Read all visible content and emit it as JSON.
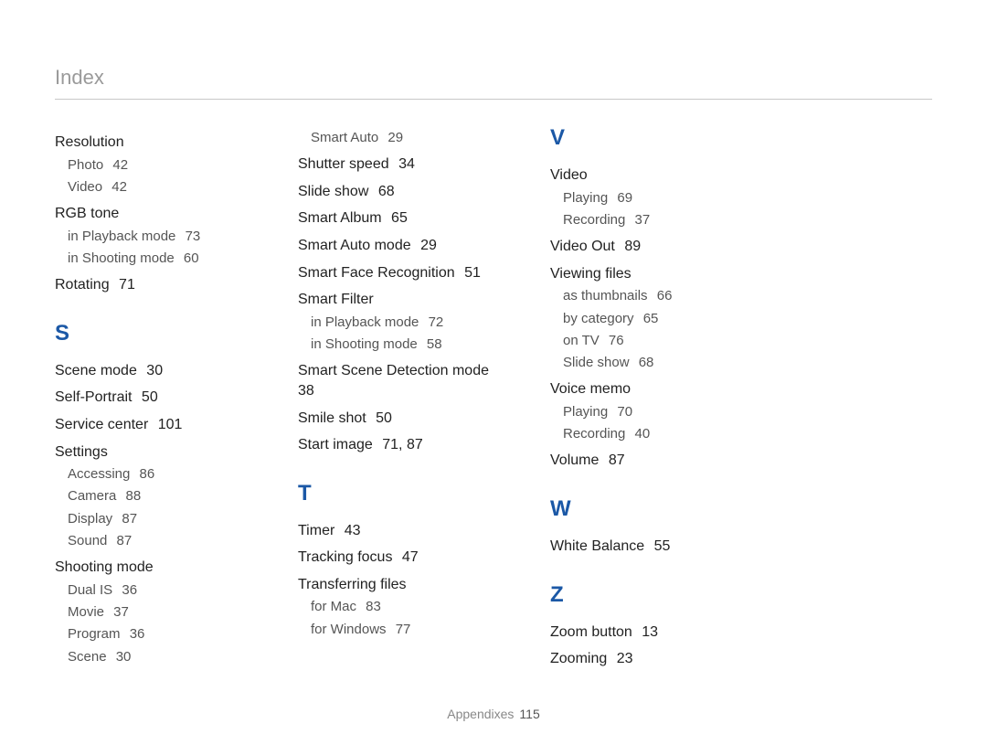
{
  "header": {
    "title": "Index"
  },
  "footer": {
    "label": "Appendixes",
    "page": "115"
  },
  "col1": [
    {
      "type": "entry",
      "label": "Resolution"
    },
    {
      "type": "sub",
      "label": "Photo",
      "page": "42"
    },
    {
      "type": "sub",
      "label": "Video",
      "page": "42"
    },
    {
      "type": "entry",
      "label": "RGB tone"
    },
    {
      "type": "sub",
      "label": "in Playback mode",
      "page": "73"
    },
    {
      "type": "sub",
      "label": "in Shooting mode",
      "page": "60"
    },
    {
      "type": "entry",
      "label": "Rotating",
      "page": "71"
    },
    {
      "type": "letter",
      "label": "S"
    },
    {
      "type": "entry",
      "label": "Scene mode",
      "page": "30"
    },
    {
      "type": "entry",
      "label": "Self-Portrait",
      "page": "50"
    },
    {
      "type": "entry",
      "label": "Service center",
      "page": "101"
    },
    {
      "type": "entry",
      "label": "Settings"
    },
    {
      "type": "sub",
      "label": "Accessing",
      "page": "86"
    },
    {
      "type": "sub",
      "label": "Camera",
      "page": "88"
    },
    {
      "type": "sub",
      "label": "Display",
      "page": "87"
    },
    {
      "type": "sub",
      "label": "Sound",
      "page": "87"
    },
    {
      "type": "entry",
      "label": "Shooting mode"
    },
    {
      "type": "sub",
      "label": "Dual IS",
      "page": "36"
    },
    {
      "type": "sub",
      "label": "Movie",
      "page": "37"
    },
    {
      "type": "sub",
      "label": "Program",
      "page": "36"
    },
    {
      "type": "sub",
      "label": "Scene",
      "page": "30"
    }
  ],
  "col2": [
    {
      "type": "sub",
      "label": "Smart Auto",
      "page": "29"
    },
    {
      "type": "entry",
      "label": "Shutter speed",
      "page": "34"
    },
    {
      "type": "entry",
      "label": "Slide show",
      "page": "68"
    },
    {
      "type": "entry",
      "label": "Smart Album",
      "page": "65"
    },
    {
      "type": "entry",
      "label": "Smart Auto mode",
      "page": "29"
    },
    {
      "type": "entry",
      "label": "Smart Face Recognition",
      "page": "51"
    },
    {
      "type": "entry",
      "label": "Smart Filter"
    },
    {
      "type": "sub",
      "label": "in Playback mode",
      "page": "72"
    },
    {
      "type": "sub",
      "label": "in Shooting mode",
      "page": "58"
    },
    {
      "type": "entry",
      "label": "Smart Scene Detection mode",
      "page": "38"
    },
    {
      "type": "entry",
      "label": "Smile shot",
      "page": "50"
    },
    {
      "type": "entry",
      "label": "Start image",
      "page": "71, 87"
    },
    {
      "type": "letter",
      "label": "T"
    },
    {
      "type": "entry",
      "label": "Timer",
      "page": "43"
    },
    {
      "type": "entry",
      "label": "Tracking focus",
      "page": "47"
    },
    {
      "type": "entry",
      "label": "Transferring files"
    },
    {
      "type": "sub",
      "label": "for Mac",
      "page": "83"
    },
    {
      "type": "sub",
      "label": "for Windows",
      "page": "77"
    }
  ],
  "col3": [
    {
      "type": "letter",
      "label": "V",
      "first": true
    },
    {
      "type": "entry",
      "label": "Video"
    },
    {
      "type": "sub",
      "label": "Playing",
      "page": "69"
    },
    {
      "type": "sub",
      "label": "Recording",
      "page": "37"
    },
    {
      "type": "entry",
      "label": "Video Out",
      "page": "89"
    },
    {
      "type": "entry",
      "label": "Viewing files"
    },
    {
      "type": "sub",
      "label": "as thumbnails",
      "page": "66"
    },
    {
      "type": "sub",
      "label": "by category",
      "page": "65"
    },
    {
      "type": "sub",
      "label": "on TV",
      "page": "76"
    },
    {
      "type": "sub",
      "label": "Slide show",
      "page": "68"
    },
    {
      "type": "entry",
      "label": "Voice memo"
    },
    {
      "type": "sub",
      "label": "Playing",
      "page": "70"
    },
    {
      "type": "sub",
      "label": "Recording",
      "page": "40"
    },
    {
      "type": "entry",
      "label": "Volume",
      "page": "87"
    },
    {
      "type": "letter",
      "label": "W"
    },
    {
      "type": "entry",
      "label": "White Balance",
      "page": "55"
    },
    {
      "type": "letter",
      "label": "Z"
    },
    {
      "type": "entry",
      "label": "Zoom button",
      "page": "13"
    },
    {
      "type": "entry",
      "label": "Zooming",
      "page": "23"
    }
  ]
}
